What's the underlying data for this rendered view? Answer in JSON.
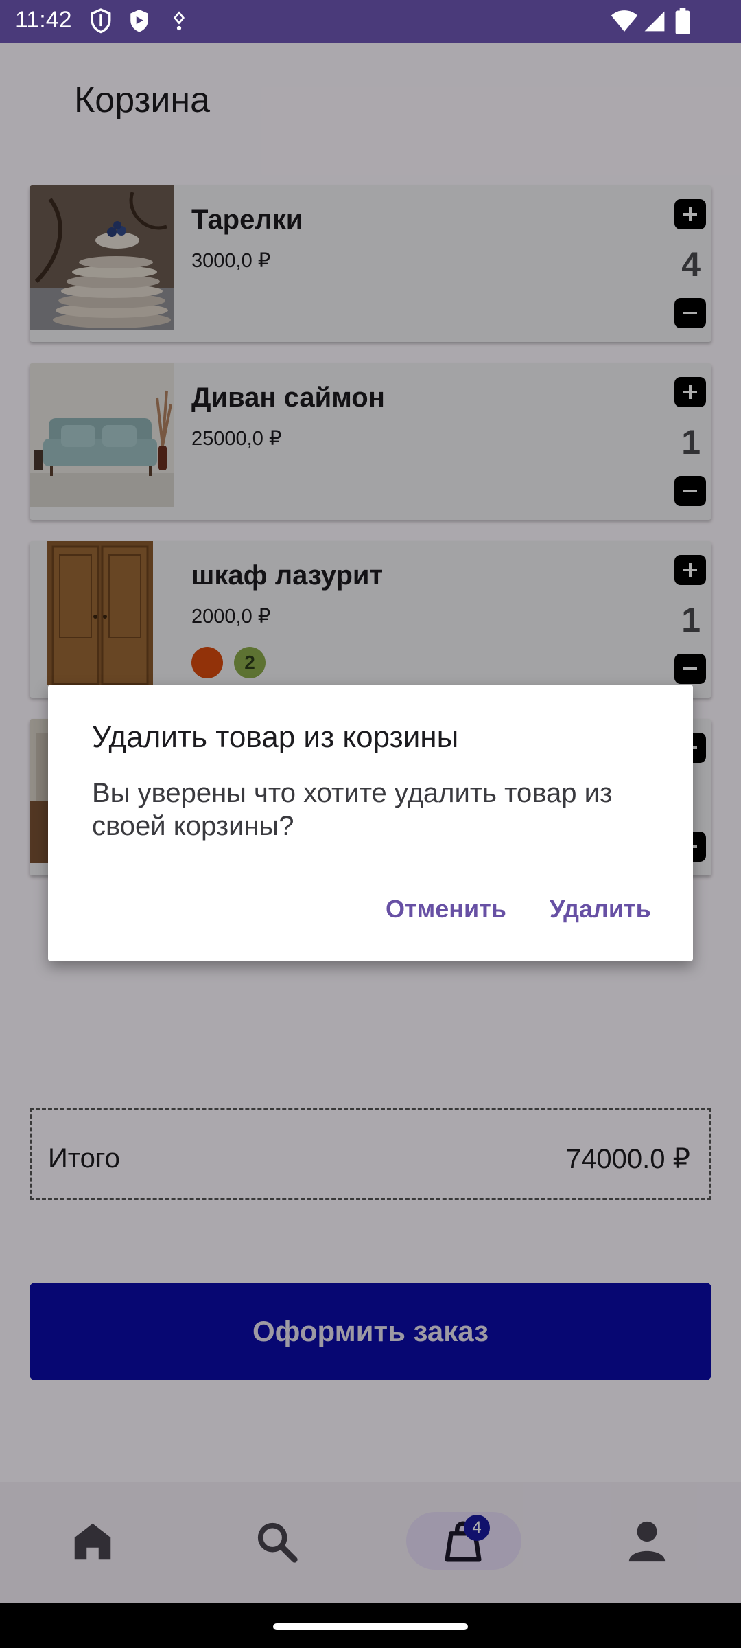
{
  "status_bar": {
    "time": "11:42"
  },
  "page": {
    "title": "Корзина"
  },
  "cart_items": [
    {
      "name": "Тарелки",
      "price": "3000,0 ₽",
      "quantity": "4"
    },
    {
      "name": "Диван саймон",
      "price": "25000,0 ₽",
      "quantity": "1"
    },
    {
      "name": "шкаф лазурит",
      "price": "2000,0 ₽",
      "quantity": "1",
      "color_count": "2",
      "colors": [
        "#d84a0e",
        "#8aa84a"
      ]
    }
  ],
  "total": {
    "label": "Итого",
    "value": "74000.0 ₽"
  },
  "order_button": {
    "label": "Оформить заказ"
  },
  "bottom_nav": {
    "cart_badge": "4"
  },
  "dialog": {
    "title": "Удалить товар из корзины",
    "message": "Вы уверены что хотите удалить товар из своей корзины?",
    "cancel_label": "Отменить",
    "confirm_label": "Удалить"
  },
  "colors": {
    "status_bar": "#4a3a7a",
    "primary_button": "#0b0ba8",
    "dialog_accent": "#6750a4",
    "nav_badge": "#1a1aa0"
  }
}
